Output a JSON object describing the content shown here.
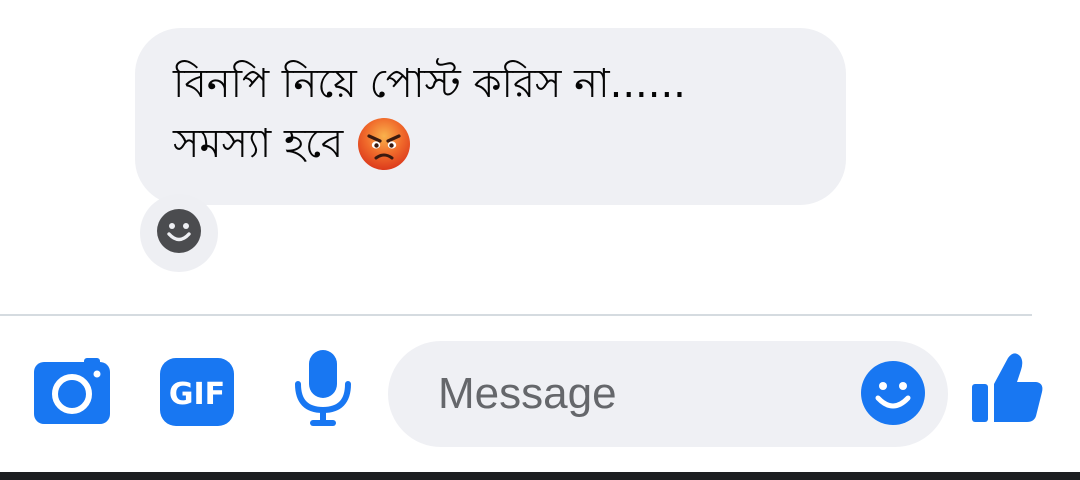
{
  "message": {
    "lines": [
      "বিনপি নিয়ে পোস্ট করিস না......",
      "সমস্যা হবে"
    ],
    "emoji": "angry-face"
  },
  "composer": {
    "placeholder": "Message",
    "gif_label": "GIF"
  },
  "colors": {
    "accent": "#1877f2",
    "bubble": "#eff0f4",
    "icon_gray": "#4b4c4f"
  }
}
